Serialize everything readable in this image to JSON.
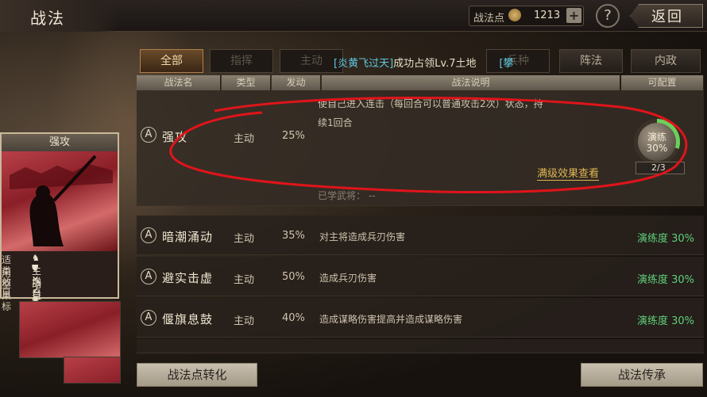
{
  "header": {
    "title": "战法",
    "points_label": "战法点",
    "points_value": "1213",
    "plus": "+",
    "help": "?",
    "back": "返回"
  },
  "tabs": [
    {
      "label": "全部",
      "active": true
    },
    {
      "label": "指挥"
    },
    {
      "label": "主动"
    },
    {
      "label": "兵种"
    },
    {
      "label": "阵法"
    },
    {
      "label": "内政"
    }
  ],
  "notice": {
    "name": "[炎黄飞过天]",
    "text": "成功占领Lv.7土地",
    "tail": "[攀"
  },
  "table": {
    "headers": [
      "战法名",
      "类型",
      "发动",
      "战法说明",
      "可配置"
    ]
  },
  "selected_tactic": {
    "badge": "A",
    "name": "强攻",
    "type": "主动",
    "rate": "25%",
    "desc_line1": "使自己进入连击（每回合可以普通攻击2次）状态，持",
    "desc_line2": "续1回合",
    "max_effect_link": "满级效果查看",
    "learned": "已学武将：  --",
    "practice_label": "演练",
    "practice_pct": "30%",
    "practice_value": 0.3,
    "slots": "2/3"
  },
  "tactics": [
    {
      "badge": "A",
      "name": "暗潮涌动",
      "type": "主动",
      "rate": "35%",
      "desc": "对主将造成兵刃伤害",
      "mastery": "演练度 30%"
    },
    {
      "badge": "A",
      "name": "避实击虚",
      "type": "主动",
      "rate": "50%",
      "desc": "造成兵刃伤害",
      "mastery": "演练度 30%"
    },
    {
      "badge": "A",
      "name": "偃旗息鼓",
      "type": "主动",
      "rate": "40%",
      "desc": "造成谋略伤害提高并造成谋略伤害",
      "mastery": "演练度 30%"
    }
  ],
  "card": {
    "title": "强攻",
    "labels": [
      "适用",
      "类型",
      "效果",
      "目标"
    ],
    "values": [
      "",
      "主动",
      "增益",
      "自己"
    ],
    "icons": "♞ ⛊ ✕ ➶ ✺"
  },
  "buttons": {
    "convert": "战法点转化",
    "inherit": "战法传承"
  }
}
